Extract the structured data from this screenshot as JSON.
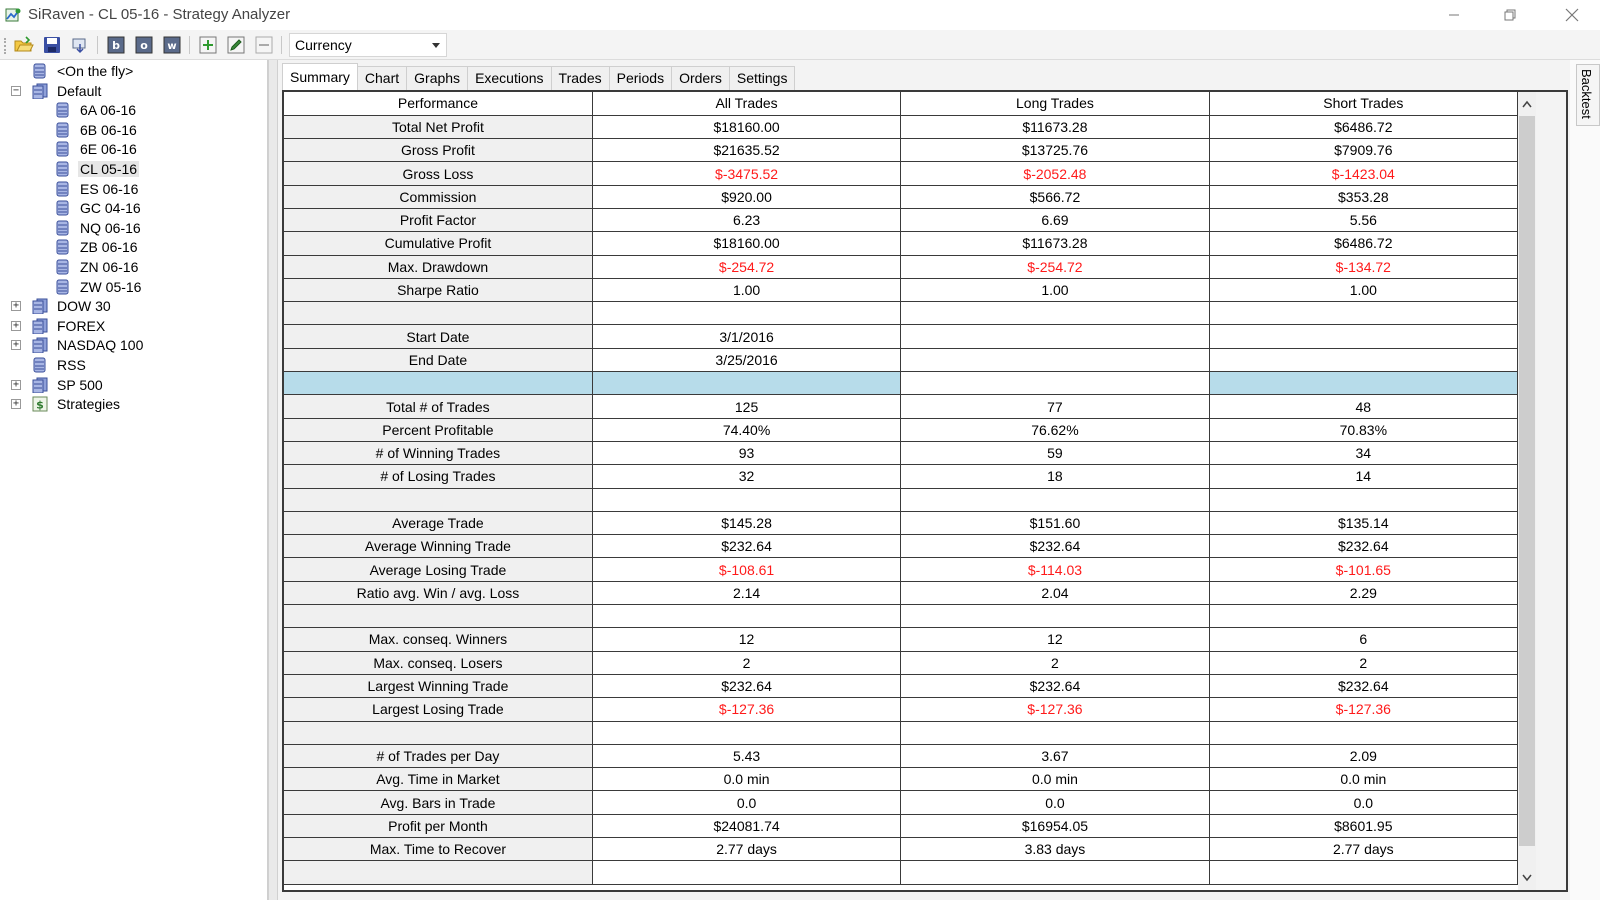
{
  "window": {
    "title": "SiRaven - CL 05-16 - Strategy Analyzer"
  },
  "toolbar": {
    "currency_value": "Currency"
  },
  "tree": {
    "items": [
      {
        "label": "<On the fly>",
        "level": 1,
        "toggle": ""
      },
      {
        "label": "Default",
        "level": 0,
        "toggle": "−"
      },
      {
        "label": "6A 06-16",
        "level": 2,
        "toggle": ""
      },
      {
        "label": "6B 06-16",
        "level": 2,
        "toggle": ""
      },
      {
        "label": "6E 06-16",
        "level": 2,
        "toggle": ""
      },
      {
        "label": "CL 05-16",
        "level": 2,
        "toggle": "",
        "selected": true
      },
      {
        "label": "ES 06-16",
        "level": 2,
        "toggle": ""
      },
      {
        "label": "GC 04-16",
        "level": 2,
        "toggle": ""
      },
      {
        "label": "NQ 06-16",
        "level": 2,
        "toggle": ""
      },
      {
        "label": "ZB 06-16",
        "level": 2,
        "toggle": ""
      },
      {
        "label": "ZN 06-16",
        "level": 2,
        "toggle": ""
      },
      {
        "label": "ZW 05-16",
        "level": 2,
        "toggle": ""
      },
      {
        "label": "DOW 30",
        "level": 0,
        "toggle": "+"
      },
      {
        "label": "FOREX",
        "level": 0,
        "toggle": "+"
      },
      {
        "label": "NASDAQ 100",
        "level": 0,
        "toggle": "+"
      },
      {
        "label": "RSS",
        "level": 1,
        "toggle": ""
      },
      {
        "label": "SP 500",
        "level": 0,
        "toggle": "+"
      },
      {
        "label": "Strategies",
        "level": 0,
        "toggle": "+",
        "icon": "strategy"
      }
    ]
  },
  "tabs": [
    "Summary",
    "Chart",
    "Graphs",
    "Executions",
    "Trades",
    "Periods",
    "Orders",
    "Settings"
  ],
  "active_tab": "Summary",
  "side_tab": "Backtest",
  "grid": {
    "headers": [
      "Performance",
      "All Trades",
      "Long Trades",
      "Short Trades"
    ],
    "rows": [
      {
        "label": "Total Net Profit",
        "values": [
          "$18160.00",
          "$11673.28",
          "$6486.72"
        ]
      },
      {
        "label": "Gross Profit",
        "values": [
          "$21635.52",
          "$13725.76",
          "$7909.76"
        ]
      },
      {
        "label": "Gross Loss",
        "values": [
          "$-3475.52",
          "$-2052.48",
          "$-1423.04"
        ],
        "negative": true
      },
      {
        "label": "Commission",
        "values": [
          "$920.00",
          "$566.72",
          "$353.28"
        ]
      },
      {
        "label": "Profit Factor",
        "values": [
          "6.23",
          "6.69",
          "5.56"
        ]
      },
      {
        "label": "Cumulative Profit",
        "values": [
          "$18160.00",
          "$11673.28",
          "$6486.72"
        ]
      },
      {
        "label": "Max. Drawdown",
        "values": [
          "$-254.72",
          "$-254.72",
          "$-134.72"
        ],
        "negative": true
      },
      {
        "label": "Sharpe Ratio",
        "values": [
          "1.00",
          "1.00",
          "1.00"
        ]
      },
      {
        "label": "",
        "values": [
          "",
          "",
          ""
        ]
      },
      {
        "label": "Start Date",
        "values": [
          "3/1/2016",
          "",
          ""
        ]
      },
      {
        "label": "End Date",
        "values": [
          "3/25/2016",
          "",
          ""
        ]
      },
      {
        "label": "",
        "values": [
          "",
          "",
          ""
        ],
        "highlight": true
      },
      {
        "label": "Total # of Trades",
        "values": [
          "125",
          "77",
          "48"
        ]
      },
      {
        "label": "Percent Profitable",
        "values": [
          "74.40%",
          "76.62%",
          "70.83%"
        ]
      },
      {
        "label": "# of Winning Trades",
        "values": [
          "93",
          "59",
          "34"
        ]
      },
      {
        "label": "# of Losing Trades",
        "values": [
          "32",
          "18",
          "14"
        ]
      },
      {
        "label": "",
        "values": [
          "",
          "",
          ""
        ]
      },
      {
        "label": "Average Trade",
        "values": [
          "$145.28",
          "$151.60",
          "$135.14"
        ]
      },
      {
        "label": "Average Winning Trade",
        "values": [
          "$232.64",
          "$232.64",
          "$232.64"
        ]
      },
      {
        "label": "Average Losing Trade",
        "values": [
          "$-108.61",
          "$-114.03",
          "$-101.65"
        ],
        "negative": true
      },
      {
        "label": "Ratio avg. Win / avg. Loss",
        "values": [
          "2.14",
          "2.04",
          "2.29"
        ]
      },
      {
        "label": "",
        "values": [
          "",
          "",
          ""
        ]
      },
      {
        "label": "Max. conseq. Winners",
        "values": [
          "12",
          "12",
          "6"
        ]
      },
      {
        "label": "Max. conseq. Losers",
        "values": [
          "2",
          "2",
          "2"
        ]
      },
      {
        "label": "Largest Winning Trade",
        "values": [
          "$232.64",
          "$232.64",
          "$232.64"
        ]
      },
      {
        "label": "Largest Losing Trade",
        "values": [
          "$-127.36",
          "$-127.36",
          "$-127.36"
        ],
        "negative": true
      },
      {
        "label": "",
        "values": [
          "",
          "",
          ""
        ]
      },
      {
        "label": "# of Trades per Day",
        "values": [
          "5.43",
          "3.67",
          "2.09"
        ]
      },
      {
        "label": "Avg. Time in Market",
        "values": [
          "0.0 min",
          "0.0 min",
          "0.0 min"
        ]
      },
      {
        "label": "Avg. Bars in Trade",
        "values": [
          "0.0",
          "0.0",
          "0.0"
        ]
      },
      {
        "label": "Profit per Month",
        "values": [
          "$24081.74",
          "$16954.05",
          "$8601.95"
        ]
      },
      {
        "label": "Max. Time to Recover",
        "values": [
          "2.77 days",
          "3.83 days",
          "2.77 days"
        ]
      },
      {
        "label": "",
        "values": [
          "",
          "",
          ""
        ]
      }
    ]
  },
  "colors": {
    "negative": "#ff1a1a",
    "highlight_row": "#b7dcea",
    "row_header_bg": "#f0f0f0"
  }
}
